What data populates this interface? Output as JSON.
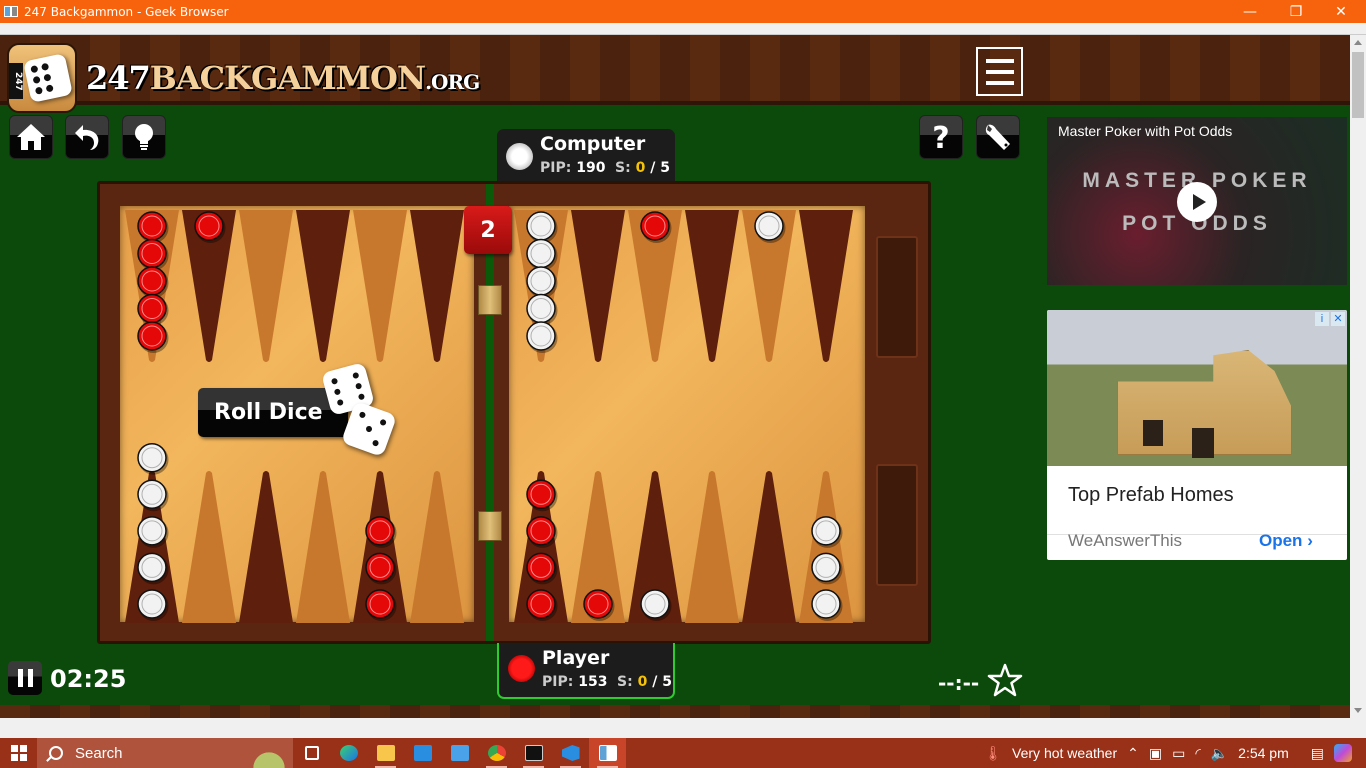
{
  "window": {
    "title": "247 Backgammon - Geek Browser",
    "minimize_icon": "minimize-icon",
    "restore_icon": "restore-icon",
    "close_icon": "close-icon"
  },
  "site": {
    "logo_badge": "247",
    "logo_text_num": "247",
    "logo_text_name": "BACKGAMMON",
    "logo_text_tld": ".ORG",
    "menu_icon": "hamburger-menu-icon"
  },
  "toolbar": {
    "left_buttons": [
      {
        "name": "home",
        "icon": "home-icon"
      },
      {
        "name": "undo",
        "icon": "undo-icon"
      },
      {
        "name": "hint",
        "icon": "lightbulb-icon"
      }
    ],
    "right_buttons": [
      {
        "name": "help",
        "icon": "question-icon"
      },
      {
        "name": "settings",
        "icon": "wrench-icon"
      }
    ]
  },
  "players": {
    "computer": {
      "name": "Computer",
      "pip_label": "PIP:",
      "pip": "190",
      "score_label": "S:",
      "score": "0",
      "score_sep": "/",
      "match_length": "5",
      "checker_color": "white"
    },
    "player": {
      "name": "Player",
      "pip_label": "PIP:",
      "pip": "153",
      "score_label": "S:",
      "score": "0",
      "score_sep": "/",
      "match_length": "5",
      "checker_color": "red",
      "active": true
    }
  },
  "doubling_cube": "2",
  "roll_button": "Roll Dice",
  "board": {
    "colors": {
      "red": "#e40808",
      "white": "#f2f2f2",
      "dark_point": "#5e1f0c",
      "light_point": "#c8782c"
    },
    "top_left_points": [
      {
        "checker": "red",
        "count": 5
      },
      {
        "checker": "red",
        "count": 1
      },
      {
        "checker": null,
        "count": 0
      },
      {
        "checker": null,
        "count": 0
      },
      {
        "checker": null,
        "count": 0
      },
      {
        "checker": null,
        "count": 0
      }
    ],
    "top_right_points": [
      {
        "checker": "white",
        "count": 5
      },
      {
        "checker": null,
        "count": 0
      },
      {
        "checker": "red",
        "count": 1
      },
      {
        "checker": null,
        "count": 0
      },
      {
        "checker": "white",
        "count": 1
      },
      {
        "checker": null,
        "count": 0
      }
    ],
    "bottom_left_points": [
      {
        "checker": "white",
        "count": 5
      },
      {
        "checker": null,
        "count": 0
      },
      {
        "checker": null,
        "count": 0
      },
      {
        "checker": null,
        "count": 0
      },
      {
        "checker": "red",
        "count": 3
      },
      {
        "checker": null,
        "count": 0
      }
    ],
    "bottom_right_points": [
      {
        "checker": "red",
        "count": 4
      },
      {
        "checker": "red",
        "count": 1
      },
      {
        "checker": "white",
        "count": 1
      },
      {
        "checker": null,
        "count": 0
      },
      {
        "checker": null,
        "count": 0
      },
      {
        "checker": "white",
        "count": 3
      }
    ]
  },
  "footer": {
    "timer": "02:25",
    "secondary_clock": "--:--",
    "pause_icon": "pause-icon",
    "favorite_icon": "star-icon"
  },
  "ads": {
    "video": {
      "title": "Master Poker with Pot Odds",
      "line1": "MASTER POKER",
      "line2": "POT ODDS"
    },
    "display": {
      "headline": "Top Prefab Homes",
      "advertiser": "WeAnswerThis",
      "cta": "Open",
      "cta_chevron": "›",
      "info": "i",
      "close": "✕"
    }
  },
  "taskbar": {
    "search_placeholder": "Search",
    "weather": "Very hot weather",
    "time": "2:54 pm",
    "apps": [
      "task-view",
      "edge",
      "file-explorer",
      "mail",
      "remote-desktop",
      "chrome",
      "terminal",
      "vscode",
      "geek-browser"
    ]
  }
}
